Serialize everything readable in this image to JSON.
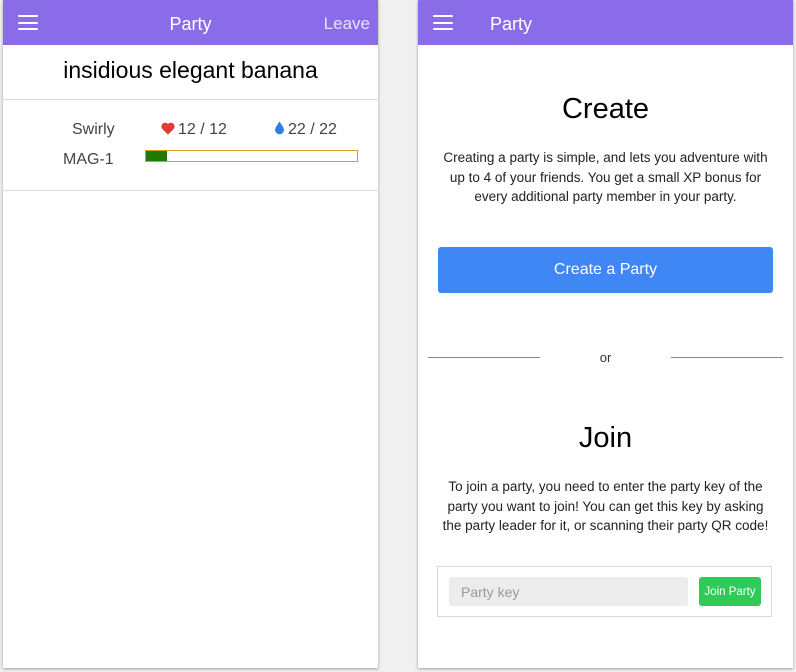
{
  "left_screen": {
    "appbar": {
      "title": "Party",
      "leave_label": "Leave",
      "menu_icon": "hamburger-menu-icon"
    },
    "party_name": "insidious elegant banana",
    "members": [
      {
        "name": "Swirly",
        "class_label": "MAG-1",
        "hp": "12 / 12",
        "mp": "22 / 22",
        "xp_fraction": 0.1,
        "hp_icon": "heart-icon",
        "mp_icon": "water-drop-icon"
      }
    ]
  },
  "right_screen": {
    "appbar": {
      "title": "Party",
      "menu_icon": "hamburger-menu-icon"
    },
    "create": {
      "heading": "Create",
      "description": "Creating a party is simple, and lets you adventure with up to 4 of your friends. You get a small XP bonus for every additional party member in your party.",
      "button_label": "Create a Party"
    },
    "divider_label": "or",
    "join": {
      "heading": "Join",
      "description": "To join a party, you need to enter the party key of the party you want to join! You can get this key by asking the party leader for it, or scanning their party QR code!",
      "input_placeholder": "Party key",
      "input_value": "",
      "button_label": "Join Party"
    }
  },
  "colors": {
    "appbar": "#8a6ce8",
    "create_button": "#3e87f5",
    "join_button": "#2fca5a",
    "heart": "#e53935",
    "drop": "#2f7fe0",
    "xp_fill": "#1f7a00",
    "xp_border": "#d4a017"
  }
}
